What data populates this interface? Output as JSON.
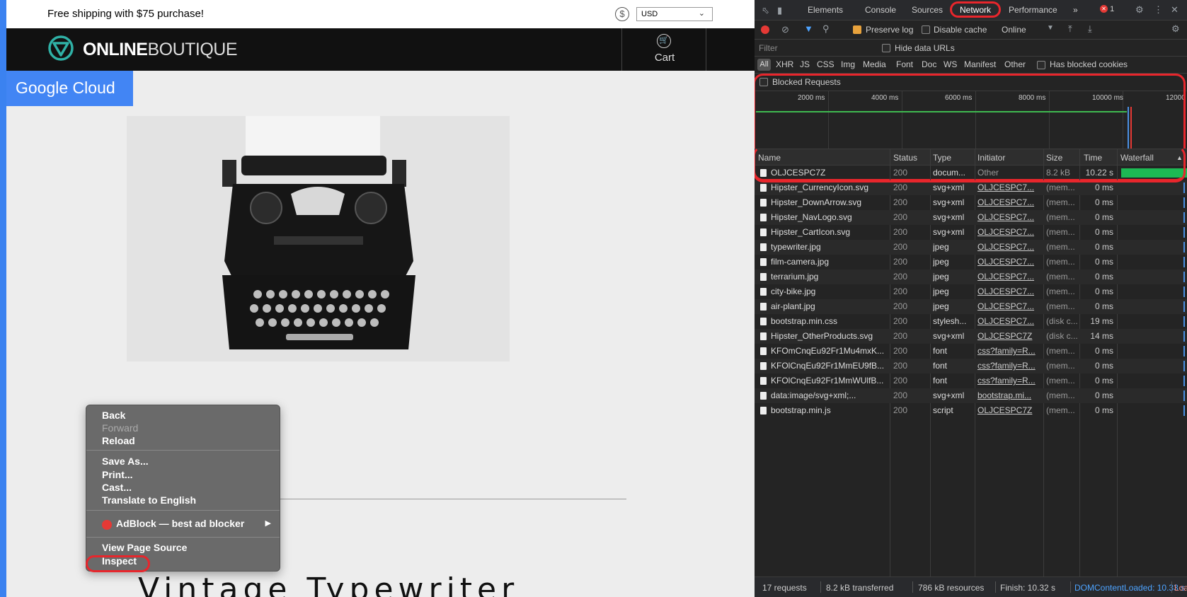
{
  "page": {
    "shipping_text": "Free shipping with $75 purchase!",
    "currency_symbol": "$",
    "currency_value": "USD",
    "logo_bold": "ONLINE",
    "logo_light": "BOUTIQUE",
    "cart_label": "Cart",
    "google_cloud": "Google Cloud",
    "product_title": "Vintage Typewriter",
    "colors": {
      "brand_teal": "#2fb1a6",
      "google_blue": "#4285f4",
      "highlight_red": "#e8262c"
    }
  },
  "context_menu": {
    "items": {
      "back": "Back",
      "forward": "Forward",
      "reload": "Reload",
      "save_as": "Save As...",
      "print": "Print...",
      "cast": "Cast...",
      "translate": "Translate to English",
      "adblock": "AdBlock — best ad blocker",
      "view_source": "View Page Source",
      "inspect": "Inspect"
    }
  },
  "devtools": {
    "tabs": {
      "elements": "Elements",
      "console": "Console",
      "sources": "Sources",
      "network": "Network",
      "performance": "Performance",
      "more": "»",
      "error_count": "1"
    },
    "toolbar": {
      "preserve_log": "Preserve log",
      "disable_cache": "Disable cache",
      "throttle": "Online"
    },
    "filter": {
      "placeholder": "Filter",
      "hide_data_urls": "Hide data URLs",
      "has_blocked_cookies": "Has blocked cookies",
      "blocked_requests": "Blocked Requests"
    },
    "types": {
      "all": "All",
      "xhr": "XHR",
      "js": "JS",
      "css": "CSS",
      "img": "Img",
      "media": "Media",
      "font": "Font",
      "doc": "Doc",
      "ws": "WS",
      "manifest": "Manifest",
      "other": "Other"
    },
    "overview_ticks": [
      "2000 ms",
      "4000 ms",
      "6000 ms",
      "8000 ms",
      "10000 ms",
      "12000"
    ],
    "columns": {
      "name": "Name",
      "status": "Status",
      "type": "Type",
      "initiator": "Initiator",
      "size": "Size",
      "time": "Time",
      "waterfall": "Waterfall"
    },
    "rows": [
      {
        "name": "OLJCESPC7Z",
        "status": "200",
        "type": "docum...",
        "initiator": "Other",
        "size": "8.2 kB",
        "time": "10.22 s"
      },
      {
        "name": "Hipster_CurrencyIcon.svg",
        "status": "200",
        "type": "svg+xml",
        "initiator": "OLJCESPC7...",
        "size": "(mem...",
        "time": "0 ms"
      },
      {
        "name": "Hipster_DownArrow.svg",
        "status": "200",
        "type": "svg+xml",
        "initiator": "OLJCESPC7...",
        "size": "(mem...",
        "time": "0 ms"
      },
      {
        "name": "Hipster_NavLogo.svg",
        "status": "200",
        "type": "svg+xml",
        "initiator": "OLJCESPC7...",
        "size": "(mem...",
        "time": "0 ms"
      },
      {
        "name": "Hipster_CartIcon.svg",
        "status": "200",
        "type": "svg+xml",
        "initiator": "OLJCESPC7...",
        "size": "(mem...",
        "time": "0 ms"
      },
      {
        "name": "typewriter.jpg",
        "status": "200",
        "type": "jpeg",
        "initiator": "OLJCESPC7...",
        "size": "(mem...",
        "time": "0 ms"
      },
      {
        "name": "film-camera.jpg",
        "status": "200",
        "type": "jpeg",
        "initiator": "OLJCESPC7...",
        "size": "(mem...",
        "time": "0 ms"
      },
      {
        "name": "terrarium.jpg",
        "status": "200",
        "type": "jpeg",
        "initiator": "OLJCESPC7...",
        "size": "(mem...",
        "time": "0 ms"
      },
      {
        "name": "city-bike.jpg",
        "status": "200",
        "type": "jpeg",
        "initiator": "OLJCESPC7...",
        "size": "(mem...",
        "time": "0 ms"
      },
      {
        "name": "air-plant.jpg",
        "status": "200",
        "type": "jpeg",
        "initiator": "OLJCESPC7...",
        "size": "(mem...",
        "time": "0 ms"
      },
      {
        "name": "bootstrap.min.css",
        "status": "200",
        "type": "stylesh...",
        "initiator": "OLJCESPC7...",
        "size": "(disk c...",
        "time": "19 ms"
      },
      {
        "name": "Hipster_OtherProducts.svg",
        "status": "200",
        "type": "svg+xml",
        "initiator": "OLJCESPC7Z",
        "size": "(disk c...",
        "time": "14 ms"
      },
      {
        "name": "KFOmCnqEu92Fr1Mu4mxK...",
        "status": "200",
        "type": "font",
        "initiator": "css?family=R...",
        "size": "(mem...",
        "time": "0 ms"
      },
      {
        "name": "KFOlCnqEu92Fr1MmEU9fB...",
        "status": "200",
        "type": "font",
        "initiator": "css?family=R...",
        "size": "(mem...",
        "time": "0 ms"
      },
      {
        "name": "KFOlCnqEu92Fr1MmWUlfB...",
        "status": "200",
        "type": "font",
        "initiator": "css?family=R...",
        "size": "(mem...",
        "time": "0 ms"
      },
      {
        "name": "data:image/svg+xml;...",
        "status": "200",
        "type": "svg+xml",
        "initiator": "bootstrap.mi...",
        "size": "(mem...",
        "time": "0 ms"
      },
      {
        "name": "bootstrap.min.js",
        "status": "200",
        "type": "script",
        "initiator": "OLJCESPC7Z",
        "size": "(mem...",
        "time": "0 ms"
      }
    ],
    "status_bar": {
      "requests": "17 requests",
      "transferred": "8.2 kB transferred",
      "resources": "786 kB resources",
      "finish": "Finish: 10.32 s",
      "dom_content_loaded": "DOMContentLoaded: 10.33 s",
      "load": "Loa"
    }
  }
}
